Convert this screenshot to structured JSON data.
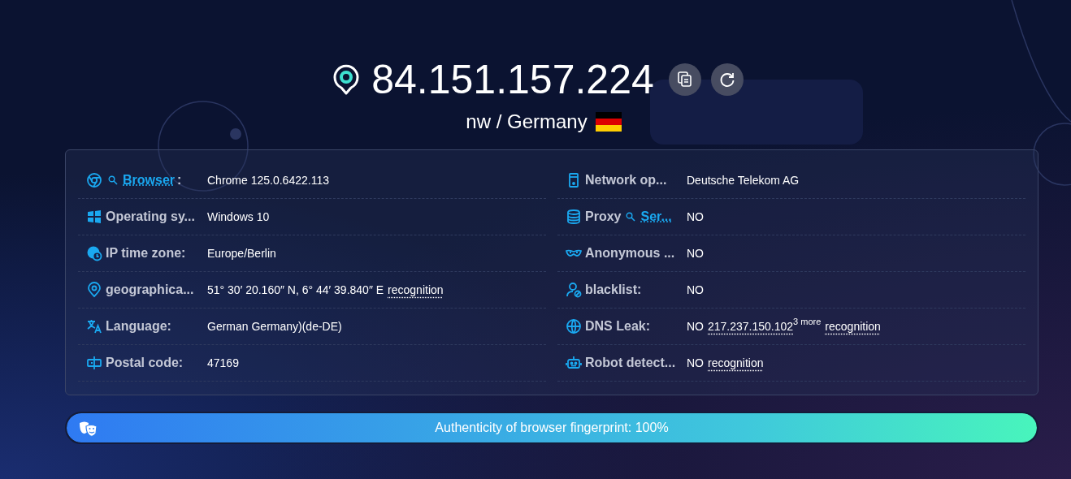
{
  "ip": "84.151.157.224",
  "location": {
    "text": "nw / Germany"
  },
  "columns": [
    [
      {
        "label": [
          {
            "kind": "link",
            "text": "Browser"
          },
          {
            "kind": "text",
            "text": ":"
          }
        ],
        "value": [
          {
            "kind": "text",
            "text": "Chrome 125.0.6422.113"
          }
        ]
      },
      {
        "label": [
          {
            "kind": "text",
            "text": "Operating sy..."
          }
        ],
        "value": [
          {
            "kind": "text",
            "text": "Windows 10"
          }
        ]
      },
      {
        "label": [
          {
            "kind": "text",
            "text": "IP time zone:"
          }
        ],
        "value": [
          {
            "kind": "text",
            "text": "Europe/Berlin"
          }
        ]
      },
      {
        "label": [
          {
            "kind": "text",
            "text": "geographica..."
          }
        ],
        "value": [
          {
            "kind": "text",
            "text": "51° 30′ 20.160″ N, 6° 44′ 39.840″ E"
          },
          {
            "kind": "link",
            "text": "recognition"
          }
        ]
      },
      {
        "label": [
          {
            "kind": "text",
            "text": "Language:"
          }
        ],
        "value": [
          {
            "kind": "text",
            "text": "German Germany)(de-DE)"
          }
        ]
      },
      {
        "label": [
          {
            "kind": "text",
            "text": "Postal code:"
          }
        ],
        "value": [
          {
            "kind": "text",
            "text": "47169"
          }
        ]
      }
    ],
    [
      {
        "label": [
          {
            "kind": "text",
            "text": "Network op..."
          }
        ],
        "value": [
          {
            "kind": "text",
            "text": "Deutsche Telekom AG"
          }
        ]
      },
      {
        "label": [
          {
            "kind": "text",
            "text": "Proxy"
          },
          {
            "kind": "link",
            "text": "Ser..."
          }
        ],
        "value": [
          {
            "kind": "text",
            "text": "NO"
          }
        ]
      },
      {
        "label": [
          {
            "kind": "text",
            "text": "Anonymous ..."
          }
        ],
        "value": [
          {
            "kind": "text",
            "text": "NO"
          }
        ]
      },
      {
        "label": [
          {
            "kind": "text",
            "text": "blacklist:"
          }
        ],
        "value": [
          {
            "kind": "text",
            "text": "NO"
          }
        ]
      },
      {
        "label": [
          {
            "kind": "text",
            "text": "DNS Leak:"
          }
        ],
        "value": [
          {
            "kind": "text",
            "text": "NO"
          },
          {
            "kind": "link",
            "text": "217.237.150.102"
          },
          {
            "kind": "sup",
            "text": "3 more"
          },
          {
            "kind": "link",
            "text": "recognition"
          }
        ]
      },
      {
        "label": [
          {
            "kind": "text",
            "text": "Robot detect..."
          }
        ],
        "value": [
          {
            "kind": "text",
            "text": "NO"
          },
          {
            "kind": "link",
            "text": "recognition"
          }
        ]
      }
    ]
  ],
  "fingerprint": {
    "text": "Authenticity of browser fingerprint: 100%",
    "level": 1
  }
}
